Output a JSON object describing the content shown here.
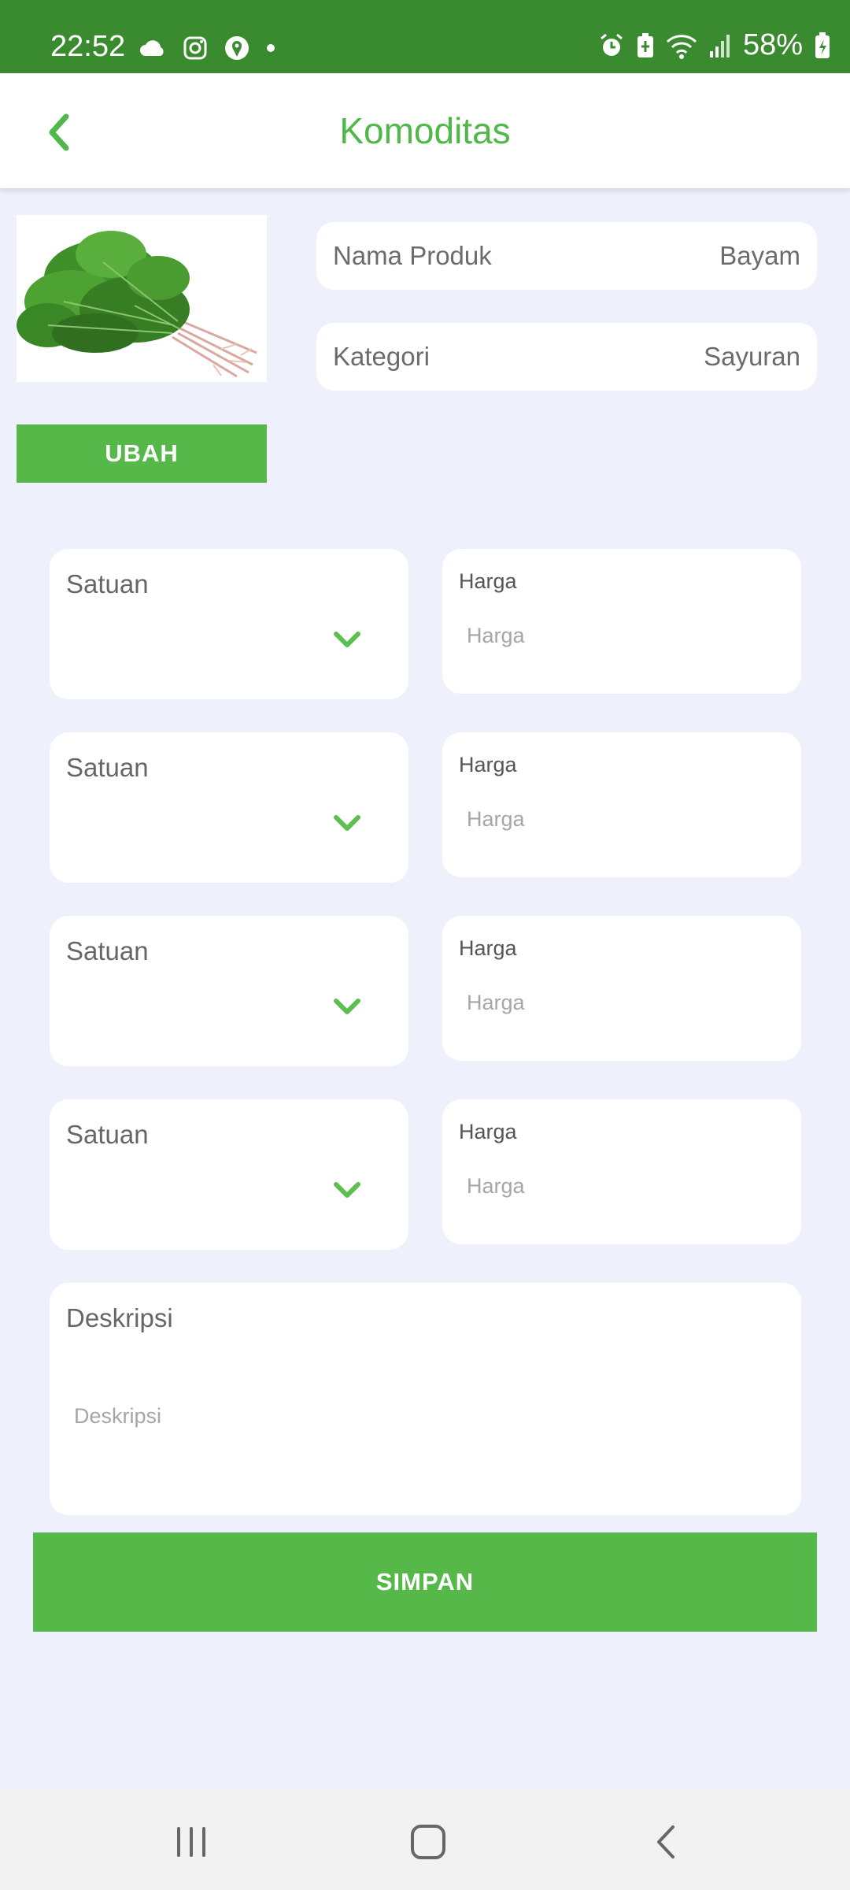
{
  "status_bar": {
    "time": "22:52",
    "battery": "58%",
    "left_icons": [
      "cloud-icon",
      "instagram-icon",
      "location-app-icon",
      "dot-icon"
    ],
    "right_icons": [
      "alarm-icon",
      "battery-saver-icon",
      "wifi-icon",
      "signal-icon",
      "battery-icon"
    ]
  },
  "header": {
    "title": "Komoditas",
    "back_icon": "chevron-left-icon"
  },
  "product": {
    "image": "spinach-bunch-image",
    "change_button": "UBAH",
    "name_label": "Nama Produk",
    "name_value": "Bayam",
    "category_label": "Kategori",
    "category_value": "Sayuran"
  },
  "units": [
    {
      "unit_label": "Satuan",
      "price_label": "Harga",
      "price_placeholder": "Harga"
    },
    {
      "unit_label": "Satuan",
      "price_label": "Harga",
      "price_placeholder": "Harga"
    },
    {
      "unit_label": "Satuan",
      "price_label": "Harga",
      "price_placeholder": "Harga"
    },
    {
      "unit_label": "Satuan",
      "price_label": "Harga",
      "price_placeholder": "Harga"
    }
  ],
  "description": {
    "label": "Deskripsi",
    "placeholder": "Deskripsi"
  },
  "save_button": "SIMPAN",
  "colors": {
    "status_bar": "#3a8a2f",
    "accent": "#57b84a",
    "title": "#4fb848",
    "background": "#eef0fc"
  },
  "nav_bar": [
    "recent-apps-icon",
    "home-icon",
    "back-icon"
  ]
}
